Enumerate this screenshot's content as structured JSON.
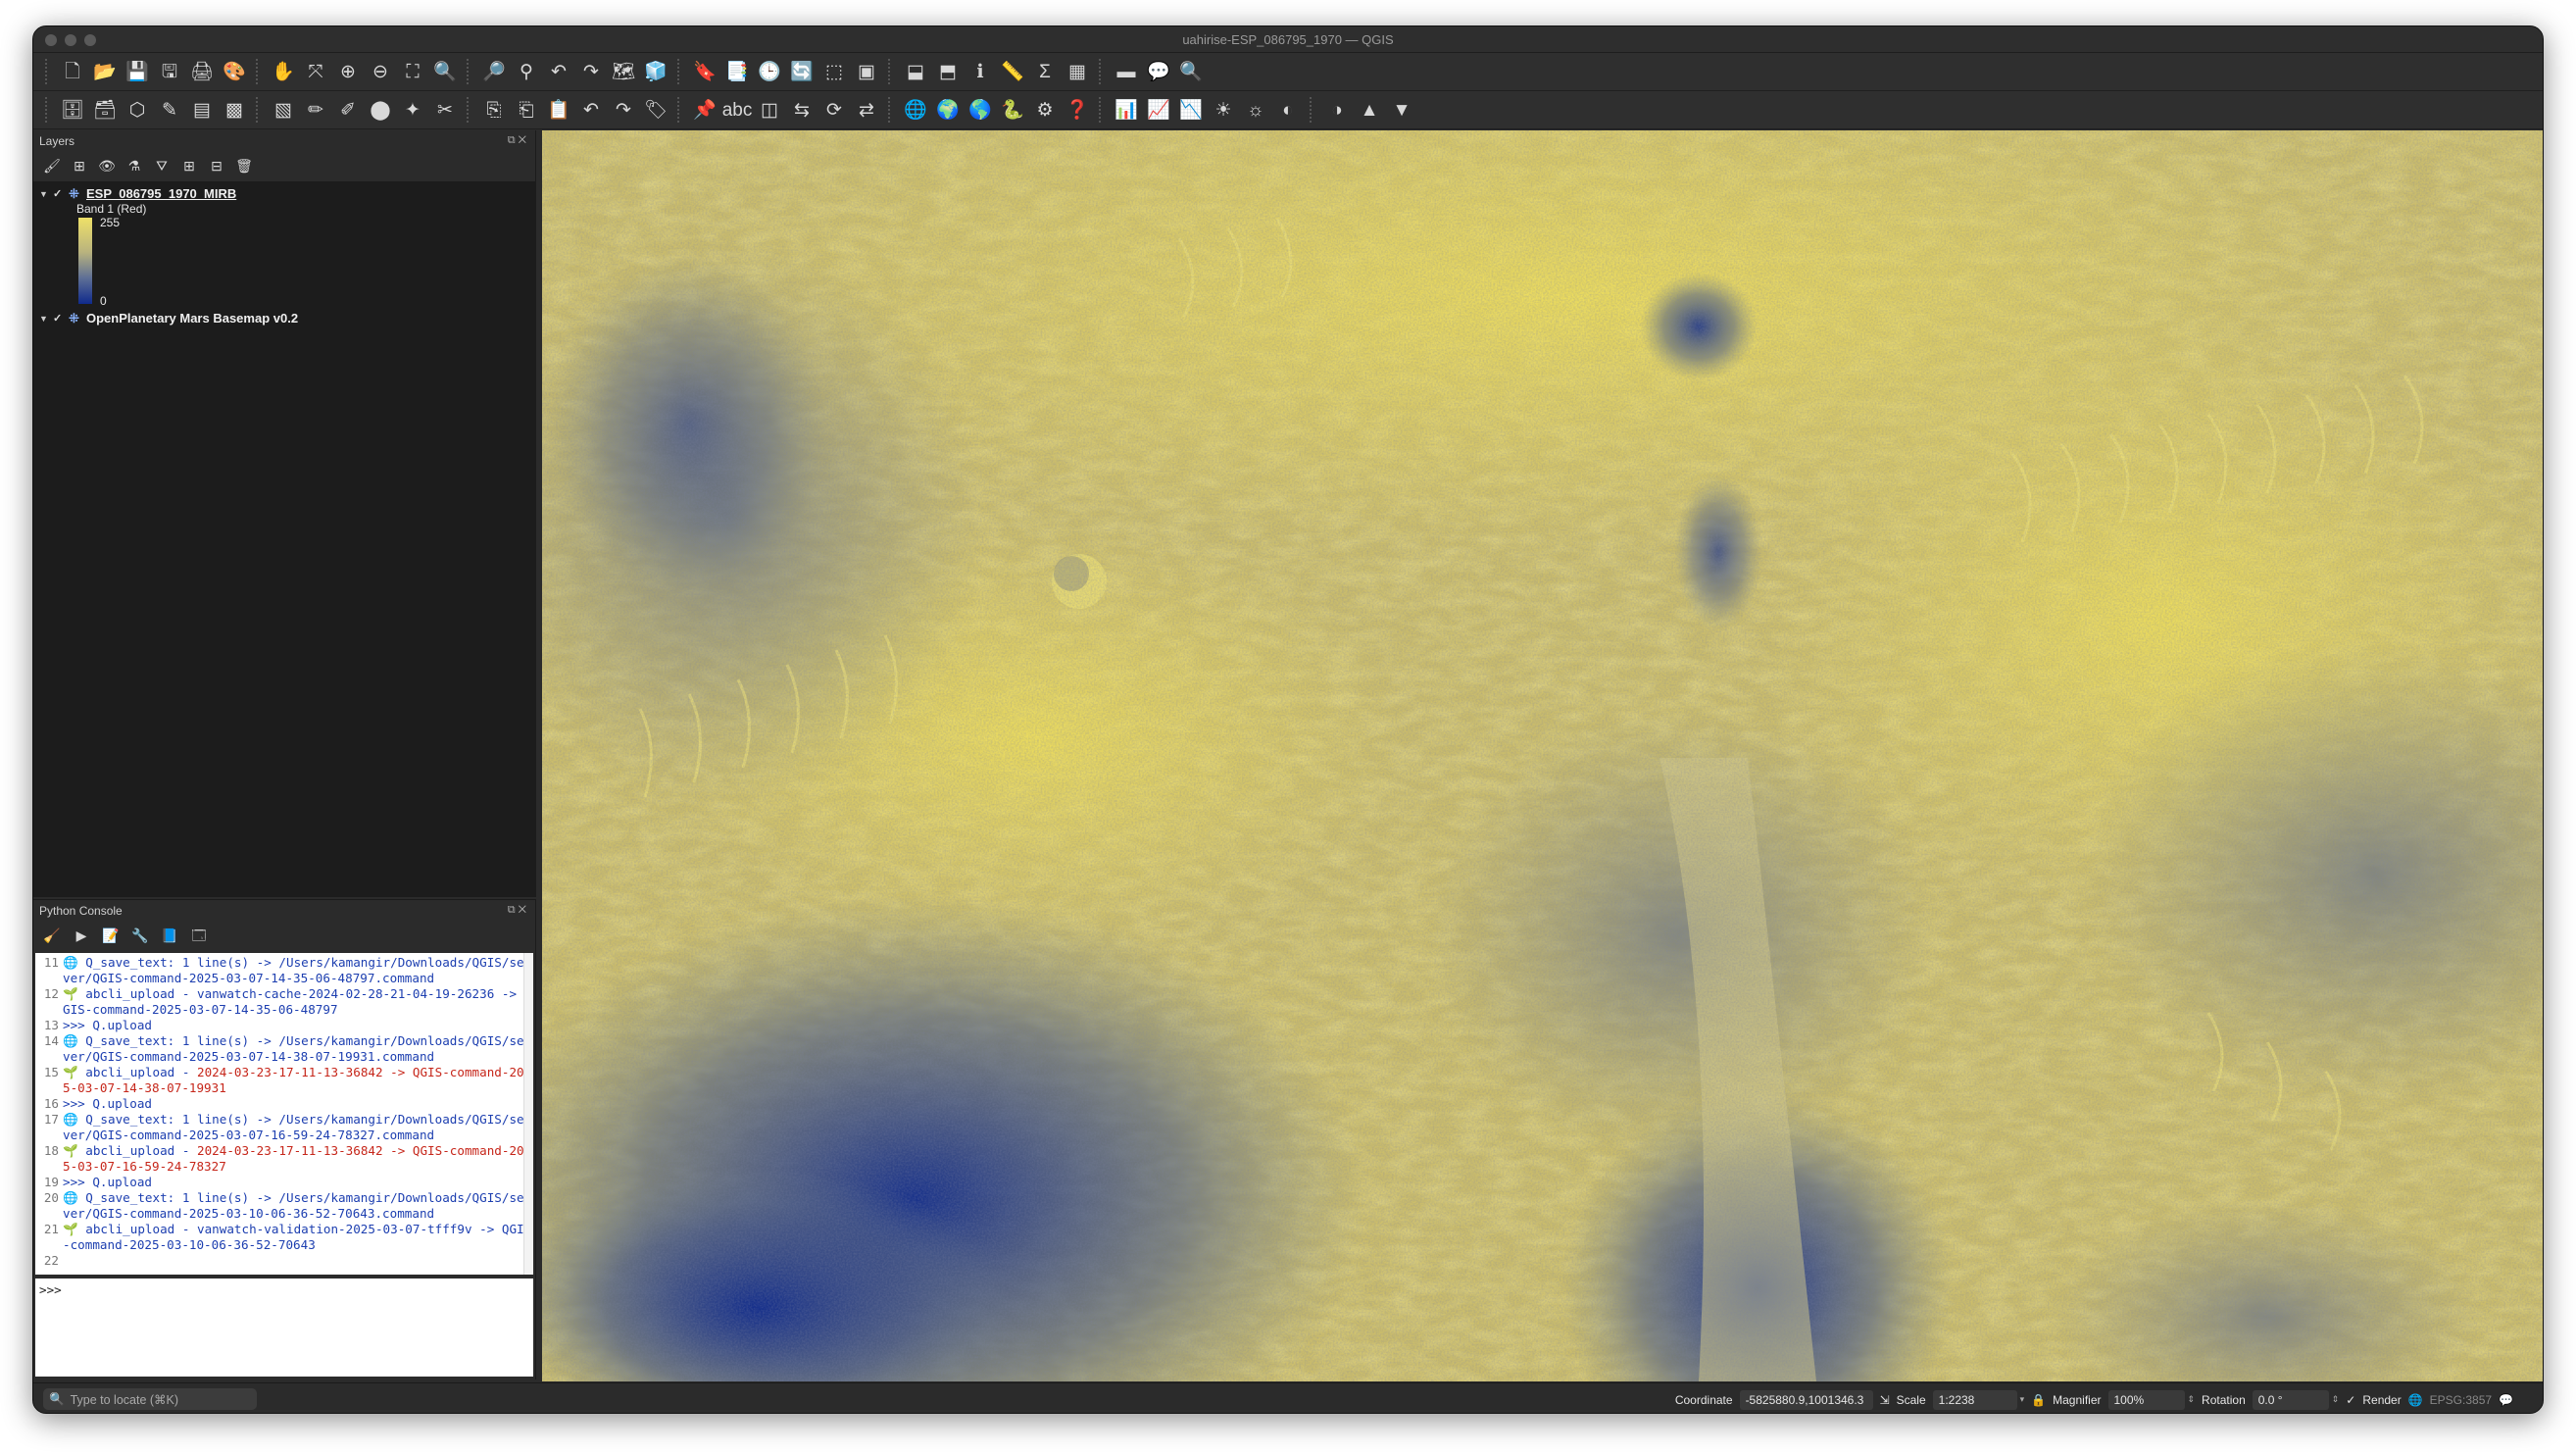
{
  "window": {
    "title": "uahirise-ESP_086795_1970 — QGIS"
  },
  "toolbar1": [
    {
      "name": "new-project-icon",
      "glyph": "🗋"
    },
    {
      "name": "open-project-icon",
      "glyph": "📂"
    },
    {
      "name": "save-project-icon",
      "glyph": "💾"
    },
    {
      "name": "save-as-icon",
      "glyph": "🖫"
    },
    {
      "name": "print-layout-icon",
      "glyph": "🖨"
    },
    {
      "name": "style-manager-icon",
      "glyph": "🎨"
    },
    {
      "name": "pan-icon",
      "glyph": "✋"
    },
    {
      "name": "pan-to-selection-icon",
      "glyph": "⤧"
    },
    {
      "name": "zoom-in-icon",
      "glyph": "⊕"
    },
    {
      "name": "zoom-out-icon",
      "glyph": "⊖"
    },
    {
      "name": "zoom-full-icon",
      "glyph": "⛶"
    },
    {
      "name": "zoom-selection-icon",
      "glyph": "🔍"
    },
    {
      "name": "zoom-layer-icon",
      "glyph": "🔎"
    },
    {
      "name": "zoom-native-icon",
      "glyph": "⚲"
    },
    {
      "name": "zoom-last-icon",
      "glyph": "↶"
    },
    {
      "name": "zoom-next-icon",
      "glyph": "↷"
    },
    {
      "name": "new-map-view-icon",
      "glyph": "🗺"
    },
    {
      "name": "new-3d-view-icon",
      "glyph": "🧊"
    },
    {
      "name": "bookmark-icon",
      "glyph": "🔖"
    },
    {
      "name": "show-bookmarks-icon",
      "glyph": "📑"
    },
    {
      "name": "temporal-controller-icon",
      "glyph": "🕒"
    },
    {
      "name": "refresh-icon",
      "glyph": "🔄"
    },
    {
      "name": "select-features-icon",
      "glyph": "⬚"
    },
    {
      "name": "select-value-icon",
      "glyph": "▣"
    },
    {
      "name": "deselect-icon",
      "glyph": "⬓"
    },
    {
      "name": "select-location-icon",
      "glyph": "⬒"
    },
    {
      "name": "identify-icon",
      "glyph": "ℹ"
    },
    {
      "name": "measure-icon",
      "glyph": "📏"
    },
    {
      "name": "statistics-icon",
      "glyph": "Σ"
    },
    {
      "name": "attribute-table-icon",
      "glyph": "▦"
    },
    {
      "name": "field-calc-icon",
      "glyph": "▬"
    },
    {
      "name": "map-tips-icon",
      "glyph": "💬"
    },
    {
      "name": "locator-zoom-icon",
      "glyph": "🔍"
    }
  ],
  "toolbar2": [
    {
      "name": "data-source-manager-icon",
      "glyph": "🗄"
    },
    {
      "name": "new-geopackage-icon",
      "glyph": "🗃"
    },
    {
      "name": "new-shapefile-icon",
      "glyph": "⬡"
    },
    {
      "name": "digitize-icon",
      "glyph": "✎"
    },
    {
      "name": "add-vector-icon",
      "glyph": "▤"
    },
    {
      "name": "add-raster-icon",
      "glyph": "▩"
    },
    {
      "name": "add-mesh-icon",
      "glyph": "▧"
    },
    {
      "name": "toggle-editing-icon",
      "glyph": "✏"
    },
    {
      "name": "save-edits-icon",
      "glyph": "✐"
    },
    {
      "name": "add-feature-icon",
      "glyph": "⬤"
    },
    {
      "name": "vertex-tool-icon",
      "glyph": "✦"
    },
    {
      "name": "delete-selected-icon",
      "glyph": "✂"
    },
    {
      "name": "cut-features-icon",
      "glyph": "⎘"
    },
    {
      "name": "copy-features-icon",
      "glyph": "⎗"
    },
    {
      "name": "paste-features-icon",
      "glyph": "📋"
    },
    {
      "name": "undo-icon",
      "glyph": "↶"
    },
    {
      "name": "redo-icon",
      "glyph": "↷"
    },
    {
      "name": "label-tool-icon",
      "glyph": "🏷"
    },
    {
      "name": "pin-labels-icon",
      "glyph": "📌"
    },
    {
      "name": "label-abc-icon",
      "glyph": "abc"
    },
    {
      "name": "show-hide-labels-icon",
      "glyph": "◫"
    },
    {
      "name": "move-label-icon",
      "glyph": "⇆"
    },
    {
      "name": "rotate-label-icon",
      "glyph": "⟳"
    },
    {
      "name": "change-label-icon",
      "glyph": "⇄"
    },
    {
      "name": "globe-icon",
      "glyph": "🌐"
    },
    {
      "name": "globe-settings-icon",
      "glyph": "🌍"
    },
    {
      "name": "globe-search-icon",
      "glyph": "🌎"
    },
    {
      "name": "python-icon",
      "glyph": "🐍"
    },
    {
      "name": "processing-icon",
      "glyph": "⚙"
    },
    {
      "name": "help-icon",
      "glyph": "❓"
    },
    {
      "name": "histogram-icon",
      "glyph": "📊"
    },
    {
      "name": "stretch-icon",
      "glyph": "📈"
    },
    {
      "name": "stretch-local-icon",
      "glyph": "📉"
    },
    {
      "name": "increase-brightness-icon",
      "glyph": "☀"
    },
    {
      "name": "decrease-brightness-icon",
      "glyph": "☼"
    },
    {
      "name": "increase-contrast-icon",
      "glyph": "◐"
    },
    {
      "name": "decrease-contrast-icon",
      "glyph": "◑"
    },
    {
      "name": "gamma-up-icon",
      "glyph": "▲"
    },
    {
      "name": "gamma-down-icon",
      "glyph": "▼"
    }
  ],
  "layers_panel": {
    "title": "Layers",
    "layers": [
      {
        "name": "ESP_086795_1970_MIRB",
        "checked": true,
        "band": "Band 1 (Red)",
        "max": "255",
        "min": "0"
      },
      {
        "name": "OpenPlanetary Mars Basemap v0.2",
        "checked": true
      }
    ]
  },
  "console": {
    "title": "Python Console",
    "prompt": ">>>",
    "lines": [
      {
        "n": "11",
        "icon": "🌐",
        "a": " Q_save_text: 1 line(s) -> /Users/kamangir/Downloads/QGIS/server/QGIS-command-2025-03-07-14-35-06-48797.command",
        "b": ""
      },
      {
        "n": "12",
        "icon": "🌱",
        "a": " abcli_upload - vanwatch-cache-2024-02-28-21-04-19-26236 -> QGIS-command-2025-03-07-14-35-06-48797",
        "b": ""
      },
      {
        "n": "13",
        "icon": "",
        "a": ">>> Q.upload",
        "b": ""
      },
      {
        "n": "14",
        "icon": "🌐",
        "a": " Q_save_text: 1 line(s) -> /Users/kamangir/Downloads/QGIS/server/QGIS-command-2025-03-07-14-38-07-19931.command",
        "b": ""
      },
      {
        "n": "15",
        "icon": "🌱",
        "a": " abcli_upload - ",
        "b": "2024-03-23-17-11-13-36842 -> QGIS-command-2025-03-07-14-38-07-19931"
      },
      {
        "n": "16",
        "icon": "",
        "a": ">>> Q.upload",
        "b": ""
      },
      {
        "n": "17",
        "icon": "🌐",
        "a": " Q_save_text: 1 line(s) -> /Users/kamangir/Downloads/QGIS/server/QGIS-command-2025-03-07-16-59-24-78327.command",
        "b": ""
      },
      {
        "n": "18",
        "icon": "🌱",
        "a": " abcli_upload - ",
        "b": "2024-03-23-17-11-13-36842 -> QGIS-command-2025-03-07-16-59-24-78327"
      },
      {
        "n": "19",
        "icon": "",
        "a": ">>> Q.upload",
        "b": ""
      },
      {
        "n": "20",
        "icon": "🌐",
        "a": " Q_save_text: 1 line(s) -> /Users/kamangir/Downloads/QGIS/server/QGIS-command-2025-03-10-06-36-52-70643.command",
        "b": ""
      },
      {
        "n": "21",
        "icon": "🌱",
        "a": " abcli_upload - vanwatch-validation-2025-03-07-tfff9v -> QGIS-command-2025-03-10-06-36-52-70643",
        "b": ""
      },
      {
        "n": "22",
        "icon": "",
        "a": "",
        "b": ""
      }
    ]
  },
  "statusbar": {
    "locate_placeholder": "Type to locate (⌘K)",
    "coordinate_label": "Coordinate",
    "coordinate_value": "-5825880.9,1001346.3",
    "scale_label": "Scale",
    "scale_value": "1:2238",
    "magnifier_label": "Magnifier",
    "magnifier_value": "100%",
    "rotation_label": "Rotation",
    "rotation_value": "0.0 °",
    "render_label": "Render",
    "crs": "EPSG:3857"
  },
  "colors": {
    "ramp_high": "#efe168",
    "ramp_low": "#0f2a8c"
  }
}
